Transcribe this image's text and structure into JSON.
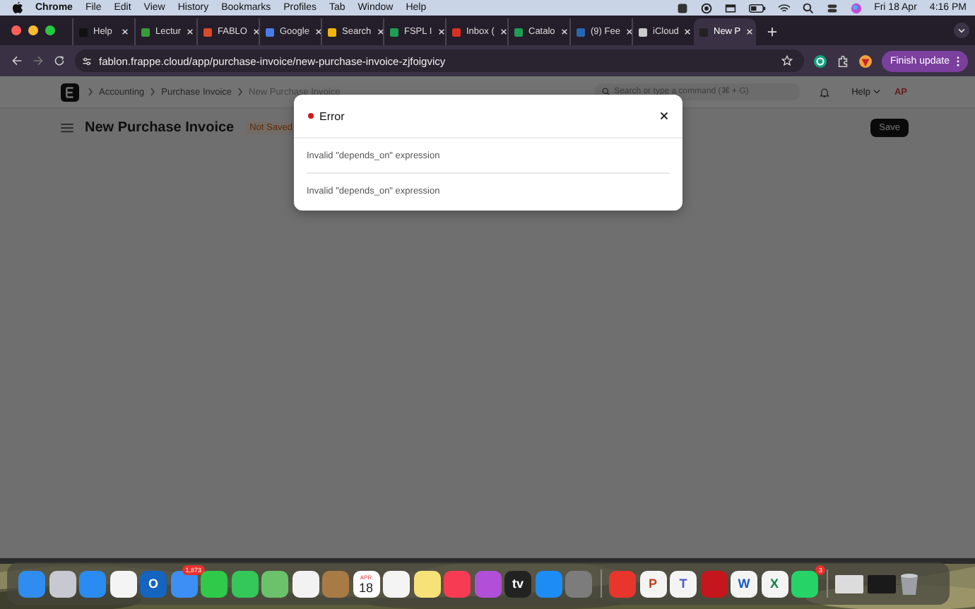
{
  "menubar": {
    "app": "Chrome",
    "items": [
      "File",
      "Edit",
      "View",
      "History",
      "Bookmarks",
      "Profiles",
      "Tab",
      "Window",
      "Help"
    ],
    "date": "Fri 18 Apr",
    "time": "4:16 PM"
  },
  "tabs": [
    {
      "label": "Help",
      "color": "#111111",
      "selected": false
    },
    {
      "label": "Lectur",
      "color": "#3a9a3a",
      "selected": false
    },
    {
      "label": "FABLO",
      "color": "#d84a2a",
      "selected": false
    },
    {
      "label": "Google",
      "color": "#4a7ce8",
      "selected": false
    },
    {
      "label": "Search",
      "color": "#f2b400",
      "selected": false
    },
    {
      "label": "FSPL I",
      "color": "#1f9d55",
      "selected": false
    },
    {
      "label": "Inbox (",
      "color": "#d93025",
      "selected": false
    },
    {
      "label": "Catalo",
      "color": "#1f9d55",
      "selected": false
    },
    {
      "label": "(9) Fee",
      "color": "#2867b2",
      "selected": false
    },
    {
      "label": "iCloud",
      "color": "#cccccc",
      "selected": false
    },
    {
      "label": "New P",
      "color": "#222222",
      "selected": true
    }
  ],
  "address_bar": {
    "url": "fablon.frappe.cloud/app/purchase-invoice/new-purchase-invoice-zjfoigvicy",
    "update_button": "Finish update"
  },
  "page": {
    "breadcrumbs": [
      "Accounting",
      "Purchase Invoice",
      "New Purchase Invoice"
    ],
    "search": {
      "placeholder": "Search or type a command (⌘ + G)"
    },
    "help": "Help",
    "avatar": "AP",
    "title": "New Purchase Invoice",
    "status": "Not Saved",
    "save_button": "Save"
  },
  "dialog": {
    "title": "Error",
    "messages": [
      "Invalid \"depends_on\" expression",
      "Invalid \"depends_on\" expression"
    ]
  },
  "dock": [
    {
      "kind": "app",
      "color": "#2f8cf0"
    },
    {
      "kind": "app",
      "color": "#c8c8d0"
    },
    {
      "kind": "app",
      "color": "#2a8cf0"
    },
    {
      "kind": "app",
      "color": "#f4f4f4"
    },
    {
      "kind": "app",
      "color": "#1464c0",
      "glyph": "O"
    },
    {
      "kind": "app",
      "color": "#3d8ff5",
      "badge": "1,873"
    },
    {
      "kind": "app",
      "color": "#2fca4a"
    },
    {
      "kind": "app",
      "color": "#34c759"
    },
    {
      "kind": "app",
      "color": "#6cc26a"
    },
    {
      "kind": "app",
      "color": "#f2f2f2"
    },
    {
      "kind": "app",
      "color": "#a87a44"
    },
    {
      "kind": "calendar",
      "color": "#ffffff",
      "month": "APR",
      "day": "18"
    },
    {
      "kind": "app",
      "color": "#f4f4f4"
    },
    {
      "kind": "app",
      "color": "#f7e27a"
    },
    {
      "kind": "app",
      "color": "#f73b53"
    },
    {
      "kind": "app",
      "color": "#b24fd8"
    },
    {
      "kind": "app",
      "color": "#222222",
      "glyph": "tv"
    },
    {
      "kind": "app",
      "color": "#1e8cf5"
    },
    {
      "kind": "app",
      "color": "#7c7c7c"
    },
    {
      "kind": "separator"
    },
    {
      "kind": "app",
      "color": "#e8362c"
    },
    {
      "kind": "app",
      "color": "#f4f4f4",
      "glyph": "P"
    },
    {
      "kind": "app",
      "color": "#f4f4f4",
      "glyph": "T"
    },
    {
      "kind": "app",
      "color": "#c4161c"
    },
    {
      "kind": "app",
      "color": "#f4f4f4",
      "glyph": "W"
    },
    {
      "kind": "app",
      "color": "#f4f4f4",
      "glyph": "X"
    },
    {
      "kind": "app",
      "color": "#25d366",
      "badge": "3"
    },
    {
      "kind": "separator"
    },
    {
      "kind": "window",
      "color": "#dcdcdc"
    },
    {
      "kind": "window",
      "color": "#1a1a1a"
    },
    {
      "kind": "trash",
      "color": "#9aa0a6"
    }
  ]
}
